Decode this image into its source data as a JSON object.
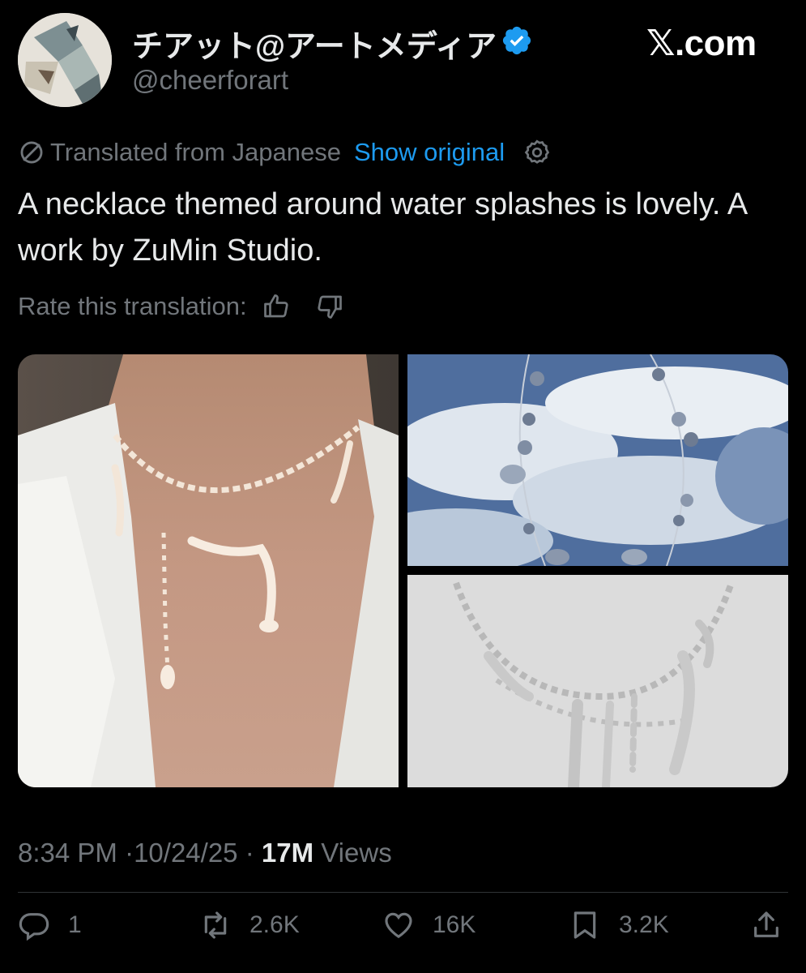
{
  "header": {
    "display_name": "チアット@アートメディア",
    "handle": "@cheerforart",
    "site": "𝕏.com"
  },
  "translation": {
    "notice": "Translated from Japanese",
    "show_original": "Show original",
    "rate_label": "Rate this translation:"
  },
  "tweet": {
    "text": "A necklace themed around water splashes is lovely. A work by ZuMin Studio."
  },
  "meta": {
    "time": "8:34 PM",
    "date": "10/24/25",
    "views_count": "17M",
    "views_label": "Views",
    "sep": "·"
  },
  "actions": {
    "replies": "1",
    "reposts": "2.6K",
    "likes": "16K",
    "bookmarks": "3.2K"
  },
  "colors": {
    "accent": "#1d9bf0",
    "muted": "#71767b",
    "text": "#e7e9ea",
    "background": "#000000"
  },
  "icons": [
    "verified-badge-icon",
    "translate-icon",
    "gear-icon",
    "thumbs-up-icon",
    "thumbs-down-icon",
    "reply-icon",
    "repost-icon",
    "like-icon",
    "bookmark-icon",
    "share-icon"
  ]
}
